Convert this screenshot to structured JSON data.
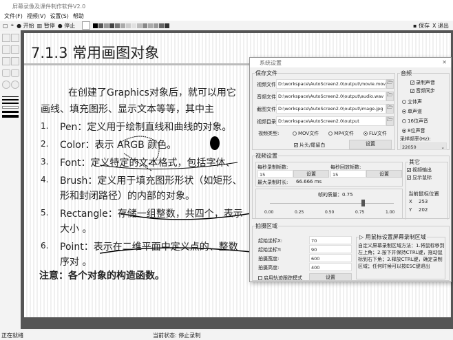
{
  "app": {
    "title": "屏幕录像及课件制作软件V2.0"
  },
  "menu": [
    "文件(F)",
    "视频(V)",
    "设置(S)",
    "帮助"
  ],
  "toolbar": {
    "start": "开始",
    "pause": "暂停",
    "stop": "停止",
    "save": "保存",
    "exit": "X 退出",
    "swatches": [
      "#000000",
      "#555555",
      "#999999",
      "#444444",
      "#777777",
      "#aaaaaa",
      "#cccccc",
      "#e0e0e0",
      "#bbbbbb",
      "#888888",
      "#aaaaaa",
      "#999999",
      "#666666",
      "#333333"
    ]
  },
  "slide": {
    "title": "7.1.3  常用画图对象",
    "intro1": "在创建了Graphics对象后，就可以用它",
    "intro2": "画线、填充图形、显示文本等等，其中主",
    "items": [
      {
        "n": "1.",
        "text": "Pen：定义用于绘制直线和曲线的对象。"
      },
      {
        "n": "2.",
        "text": "Color：表示 ARGB 颜色。"
      },
      {
        "n": "3.",
        "text": "Font：定义特定的文本格式，包括字体、"
      },
      {
        "n": "4.",
        "text": "Brush：定义用于填充图形形状（如矩形、",
        "cont": "形和封闭路径）的内部的对象。"
      },
      {
        "n": "5.",
        "text": "Rectangle：存储一组整数，共四个，表示",
        "cont": "大小 。"
      },
      {
        "n": "6.",
        "text": "Point：表示在二维平面中定义点的、整数",
        "cont": "序对 。"
      }
    ],
    "note": "注意：各个对象的构造函数。"
  },
  "dialog": {
    "title": "系统设置",
    "save": {
      "title": "保存文件",
      "rows": [
        {
          "label": "视频文件",
          "value": "D:\\workspace\\AutoScreen2.0\\output\\movie.mov"
        },
        {
          "label": "音频文件",
          "value": "D:\\workspace\\AutoScreen2.0\\output\\audio.wav"
        },
        {
          "label": "截图文件",
          "value": "D:\\workspace\\AutoScreen2.0\\output\\image.jpg"
        },
        {
          "label": "视频目录",
          "value": "D:\\workspace\\AutoScreen2.0\\output"
        }
      ],
      "type_label": "视频类型:",
      "types": [
        "MOV文件",
        "MP4文件",
        "FLV文件"
      ],
      "selected_type": "FLV文件",
      "leave_blank": "片头/尾留白",
      "set": "设置"
    },
    "audio": {
      "title": "音频",
      "record": "录制声音",
      "sync": "音频同步",
      "channels": [
        "立体声",
        "单声道"
      ],
      "channel": "单声道",
      "bits": [
        "16位声音",
        "8位声音"
      ],
      "bit": "8位声音",
      "rate_label": "采样频率(Hz):",
      "rate": "22050"
    },
    "video": {
      "title": "视频设置",
      "fps_label": "每秒录制帧数:",
      "fps": "15",
      "play_label": "每秒回放帧数:",
      "play": "15",
      "set": "设置",
      "max_label": "最大录制时长:",
      "max": "66.666 ms",
      "quality_label": "帧的质量：0.75",
      "quality": 0.75,
      "ticks": [
        "0.00",
        "0.25",
        "0.50",
        "0.75",
        "1.00"
      ],
      "other": {
        "title": "其它",
        "video_out": "视频输出",
        "show_mouse": "显示鼠标",
        "pos_title": "当前鼠标位置",
        "x_label": "X",
        "x": "253",
        "y_label": "Y",
        "y": "202"
      }
    },
    "area": {
      "title": "拍摄区域",
      "rows": [
        {
          "label": "起始坐标X:",
          "value": "70"
        },
        {
          "label": "起始坐标Y:",
          "value": "90"
        },
        {
          "label": "拍摄宽度:",
          "value": "600"
        },
        {
          "label": "拍摄高度:",
          "value": "400"
        }
      ],
      "track": "启用轨迹跟踪模式",
      "set": "设置",
      "mouse_title": "用鼠标设置屏幕录制区域",
      "help": "自定义屏幕录制区域方法：1.将鼠标移到左上角；2.按下并保持CTRL键，拖动鼠标到右下角；3.释放CTRL键，确定录制区域；任何时候可以按ESC键退出"
    }
  },
  "status": {
    "left": "正在就绪",
    "center": "当前状态: 停止录制"
  }
}
